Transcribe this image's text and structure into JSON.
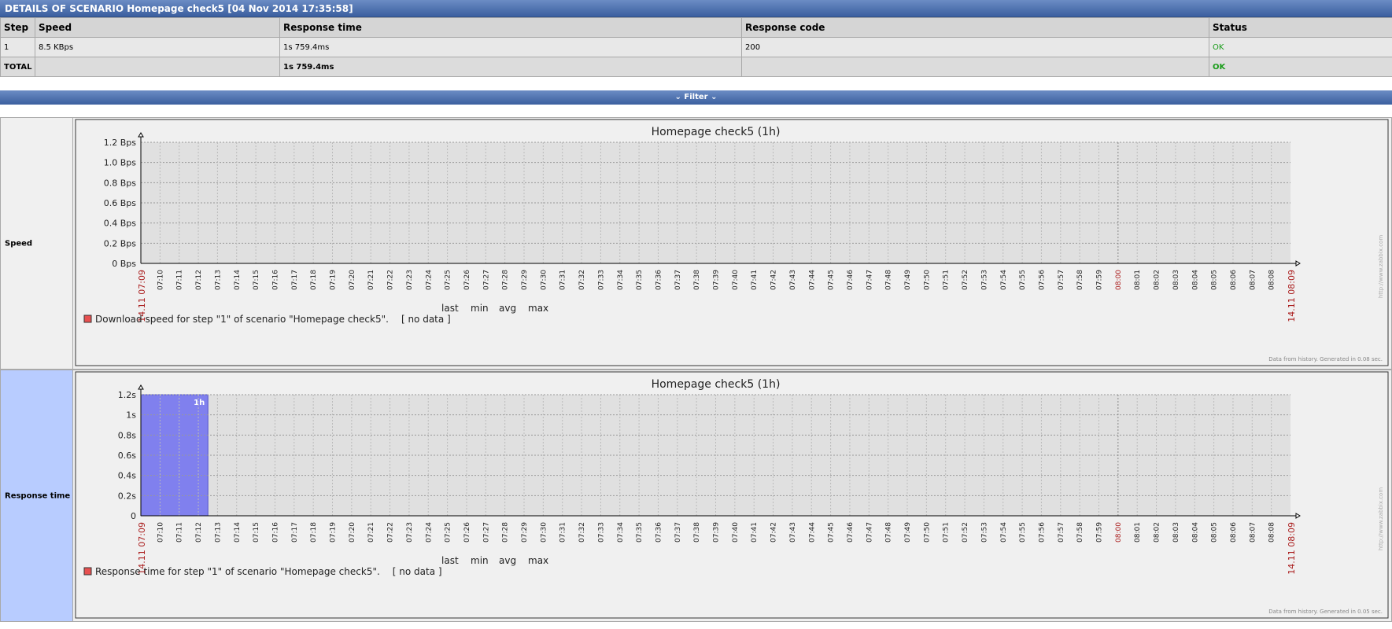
{
  "header": {
    "title": "DETAILS OF SCENARIO Homepage check5 [04 Nov 2014 17:35:58]"
  },
  "steps_table": {
    "columns": [
      "Step",
      "Speed",
      "Response time",
      "Response code",
      "Status"
    ],
    "rows": [
      {
        "step": "1",
        "speed": "8.5 KBps",
        "response_time": "1s 759.4ms",
        "response_code": "200",
        "status": "OK"
      }
    ],
    "total": {
      "label": "TOTAL",
      "response_time": "1s 759.4ms",
      "status": "OK"
    }
  },
  "filter": {
    "label": "⌄ Filter ⌄"
  },
  "graphs": {
    "speed": {
      "row_label": "Speed",
      "title": "Homepage check5 (1h)",
      "legend_headers": [
        "last",
        "min",
        "avg",
        "max"
      ],
      "legend_text": "Download speed for step \"1\" of scenario \"Homepage check5\".",
      "legend_nodata": "[ no data ]",
      "footer": "Data from history. Generated in 0.08 sec.",
      "watermark": "http://www.zabbix.com"
    },
    "response": {
      "row_label": "Response time",
      "title": "Homepage check5 (1h)",
      "legend_headers": [
        "last",
        "min",
        "avg",
        "max"
      ],
      "legend_text": "Response time for step \"1\" of scenario \"Homepage check5\".",
      "legend_nodata": "[ no data ]",
      "footer": "Data from history. Generated in 0.05 sec.",
      "watermark": "http://www.zabbix.com",
      "bar_label": "1h"
    }
  },
  "chart_data": [
    {
      "type": "bar",
      "title": "Homepage check5 (1h)",
      "y_ticks": [
        "0 Bps",
        "0.2 Bps",
        "0.4 Bps",
        "0.6 Bps",
        "0.8 Bps",
        "1.0 Bps",
        "1.2 Bps"
      ],
      "ylim": [
        0,
        1.2
      ],
      "x_start_label": "14.11 07:09",
      "x_end_label": "14.11 08:09",
      "x_ticks": [
        "07:10",
        "07:11",
        "07:12",
        "07:13",
        "07:14",
        "07:15",
        "07:16",
        "07:17",
        "07:18",
        "07:19",
        "07:20",
        "07:21",
        "07:22",
        "07:23",
        "07:24",
        "07:25",
        "07:26",
        "07:27",
        "07:28",
        "07:29",
        "07:30",
        "07:31",
        "07:32",
        "07:33",
        "07:34",
        "07:35",
        "07:36",
        "07:37",
        "07:38",
        "07:39",
        "07:40",
        "07:41",
        "07:42",
        "07:43",
        "07:44",
        "07:45",
        "07:46",
        "07:47",
        "07:48",
        "07:49",
        "07:50",
        "07:51",
        "07:52",
        "07:53",
        "07:54",
        "07:55",
        "07:56",
        "07:57",
        "07:58",
        "07:59",
        "08:00",
        "08:01",
        "08:02",
        "08:03",
        "08:04",
        "08:05",
        "08:06",
        "08:07",
        "08:08"
      ],
      "series": []
    },
    {
      "type": "bar",
      "title": "Homepage check5 (1h)",
      "y_ticks": [
        "0",
        "0.2s",
        "0.4s",
        "0.6s",
        "0.8s",
        "1s",
        "1.2s"
      ],
      "ylim": [
        0,
        1.2
      ],
      "x_start_label": "14.11 07:09",
      "x_end_label": "14.11 08:09",
      "x_ticks": [
        "07:10",
        "07:11",
        "07:12",
        "07:13",
        "07:14",
        "07:15",
        "07:16",
        "07:17",
        "07:18",
        "07:19",
        "07:20",
        "07:21",
        "07:22",
        "07:23",
        "07:24",
        "07:25",
        "07:26",
        "07:27",
        "07:28",
        "07:29",
        "07:30",
        "07:31",
        "07:32",
        "07:33",
        "07:34",
        "07:35",
        "07:36",
        "07:37",
        "07:38",
        "07:39",
        "07:40",
        "07:41",
        "07:42",
        "07:43",
        "07:44",
        "07:45",
        "07:46",
        "07:47",
        "07:48",
        "07:49",
        "07:50",
        "07:51",
        "07:52",
        "07:53",
        "07:54",
        "07:55",
        "07:56",
        "07:57",
        "07:58",
        "07:59",
        "08:00",
        "08:01",
        "08:02",
        "08:03",
        "08:04",
        "08:05",
        "08:06",
        "08:07",
        "08:08"
      ],
      "series": [
        {
          "x_start": "07:09",
          "x_end": "07:12:30",
          "value": 1.2,
          "label": "1h"
        }
      ]
    }
  ],
  "colors": {
    "legend_swatch": "#e85050",
    "highlight_row": "#b8ccff",
    "bar_fill": "#8080ee",
    "hour_label": "#aa1c1c"
  }
}
